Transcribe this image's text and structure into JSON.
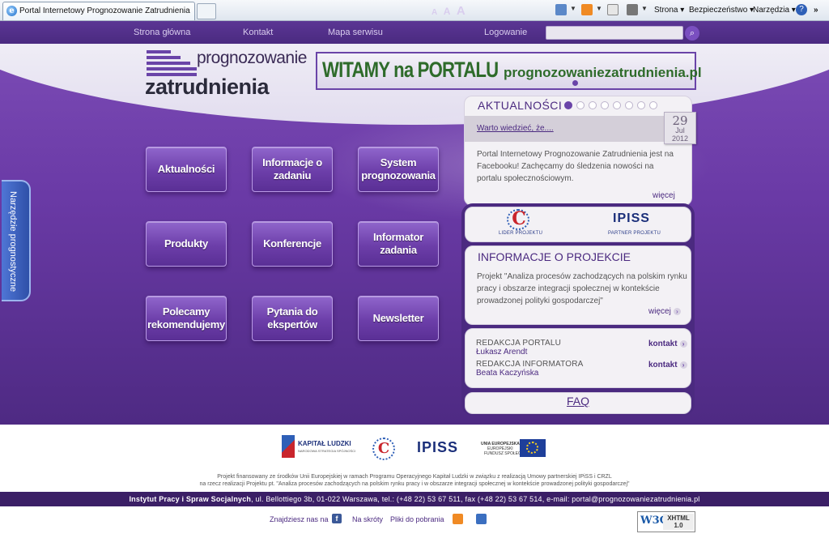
{
  "browser": {
    "tab_title": "Portal Internetowy Prognozowanie Zatrudnienia",
    "menu": {
      "page": "Strona",
      "security": "Bezpieczeństwo",
      "tools": "Narzędzia",
      "more": "»"
    }
  },
  "nav": {
    "home": "Strona główna",
    "contact": "Kontakt",
    "sitemap": "Mapa serwisu",
    "font_small": "A",
    "font_medium": "A",
    "font_large": "A",
    "login": "Logowanie",
    "search_placeholder": ""
  },
  "logo": {
    "line1": "prognozowanie",
    "line2": "zatrudnienia"
  },
  "banner": {
    "title": "WITAMY na PORTALU",
    "url": "prognozowaniezatrudnienia.pl"
  },
  "side_tab": {
    "label": "Narzędzie prognostyczne"
  },
  "menu_buttons": [
    {
      "label": "Aktualności"
    },
    {
      "label": "Informacje o zadaniu"
    },
    {
      "label": "System prognozowania"
    },
    {
      "label": "Produkty"
    },
    {
      "label": "Konferencje"
    },
    {
      "label": "Informator zadania"
    },
    {
      "label": "Polecamy rekomendujemy"
    },
    {
      "label": "Pytania do ekspertów"
    },
    {
      "label": "Newsletter"
    }
  ],
  "news": {
    "heading": "AKTUALNOŚCI",
    "dots_total": 8,
    "dot_active": 1,
    "link": "Warto wiedzieć, że....",
    "date_day": "29",
    "date_month": "Jul",
    "date_year": "2012",
    "text": "Portal Internetowy Prognozowanie Zatrudnienia jest na Facebooku! Zachęcamy do śledzenia nowości na portalu społecznościowym.",
    "more": "więcej"
  },
  "partners": {
    "leader_caption": "LIDER PROJEKTU",
    "partner_name": "IPISS",
    "partner_caption": "PARTNER PROJEKTU",
    "leader_logo": "C"
  },
  "project_info": {
    "heading": "INFORMACJE O PROJEKCIE",
    "text": "Projekt \"Analiza procesów zachodzących na polskim rynku pracy i obszarze integracji społecznej w kontekście prowadzonej polityki gospodarczej\"",
    "more": "więcej"
  },
  "contacts": [
    {
      "label": "REDAKCJA PORTALU",
      "name": "Łukasz Arendt",
      "link": "kontakt"
    },
    {
      "label": "REDAKCJA INFORMATORA",
      "name": "Beata Kaczyńska",
      "link": "kontakt"
    }
  ],
  "faq": "FAQ",
  "footer": {
    "kl_title": "KAPITAŁ LUDZKI",
    "kl_sub": "NARODOWA STRATEGIA SPÓJNOŚCI",
    "c_logo": "C",
    "ipiss": "IPISS",
    "eu_line1": "UNIA EUROPEJSKA",
    "eu_line2": "EUROPEJSKI",
    "eu_line3": "FUNDUSZ SPOŁECZNY",
    "funding_line1": "Projekt finansowany ze środków Unii Europejskiej w ramach Programu Operacyjnego Kapitał Ludzki w związku z realizacją Umowy partnerskiej IPiSS i CRZL",
    "funding_line2": "na rzecz realizacji Projektu pt. \"Analiza procesów zachodzących na polskim rynku pracy i w obszarze integracji społecznej w kontekście prowadzonej polityki gospodarczej\"",
    "institute": "Instytut Pracy i Spraw Socjalnych",
    "address": ", ul. Bellottiego 3b, 01-022 Warszawa, tel.: (+48 22) 53 67 511, fax (+48 22) 53 67 514, e-mail: portal@prognozowaniezatrudnienia.pl",
    "find_us": "Znajdziesz nas na",
    "fb": "f",
    "shortcuts": "Na skróty",
    "downloads": "Pliki do pobrania",
    "w3c": "W3C",
    "xhtml": "XHTML",
    "xhtml_ver": "1.0"
  },
  "colors": {
    "purple_dark": "#4b2a80",
    "purple_main": "#6a3aa6",
    "banner_green": "#2e6b2a",
    "rss_orange": "#f08a24"
  }
}
